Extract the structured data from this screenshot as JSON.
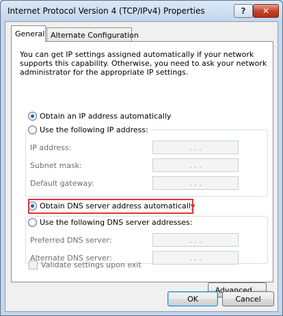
{
  "window": {
    "title": "Internet Protocol Version 4 (TCP/IPv4) Properties",
    "help_label": "?",
    "close_label": "✕"
  },
  "tabs": [
    {
      "label": "General"
    },
    {
      "label": "Alternate Configuration"
    }
  ],
  "description": "You can get IP settings assigned automatically if your network supports this capability. Otherwise, you need to ask your network administrator for the appropriate IP settings.",
  "ip": {
    "auto_label": "Obtain an IP address automatically",
    "manual_label": "Use the following IP address:",
    "fields": [
      {
        "label": "IP address:",
        "value": ". . ."
      },
      {
        "label": "Subnet mask:",
        "value": ". . ."
      },
      {
        "label": "Default gateway:",
        "value": ". . ."
      }
    ]
  },
  "dns": {
    "auto_label": "Obtain DNS server address automatically",
    "manual_label": "Use the following DNS server addresses:",
    "fields": [
      {
        "label": "Preferred DNS server:",
        "value": ". . ."
      },
      {
        "label": "Alternate DNS server:",
        "value": ". . ."
      }
    ]
  },
  "validate_label": "Validate settings upon exit",
  "buttons": {
    "advanced": "Advanced...",
    "ok": "OK",
    "cancel": "Cancel"
  },
  "colors": {
    "highlight": "#e53239",
    "radio_dot": "#1a5fb8"
  },
  "icons": [
    "help-icon",
    "close-icon"
  ]
}
